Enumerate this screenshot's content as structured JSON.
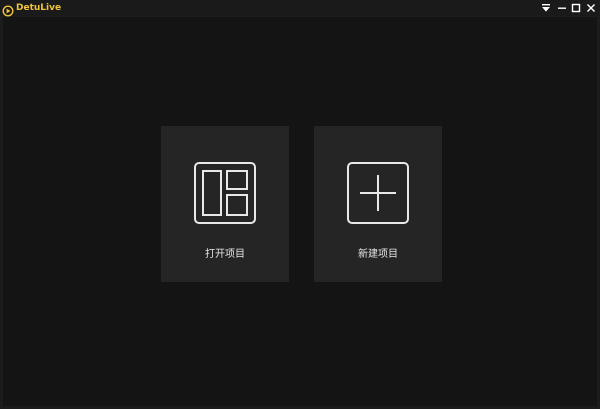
{
  "window": {
    "title": "DetuLive",
    "accent_color": "#f0c43a",
    "controls": [
      {
        "name": "menu-dropdown",
        "icon": "dropdown-menu-icon"
      },
      {
        "name": "minimize",
        "icon": "minimize-icon"
      },
      {
        "name": "maximize",
        "icon": "maximize-icon"
      },
      {
        "name": "close",
        "icon": "close-icon"
      }
    ]
  },
  "home": {
    "open_project": {
      "label": "打开项目",
      "icon": "layout-panels-icon"
    },
    "new_project": {
      "label": "新建项目",
      "icon": "plus-square-icon"
    }
  }
}
